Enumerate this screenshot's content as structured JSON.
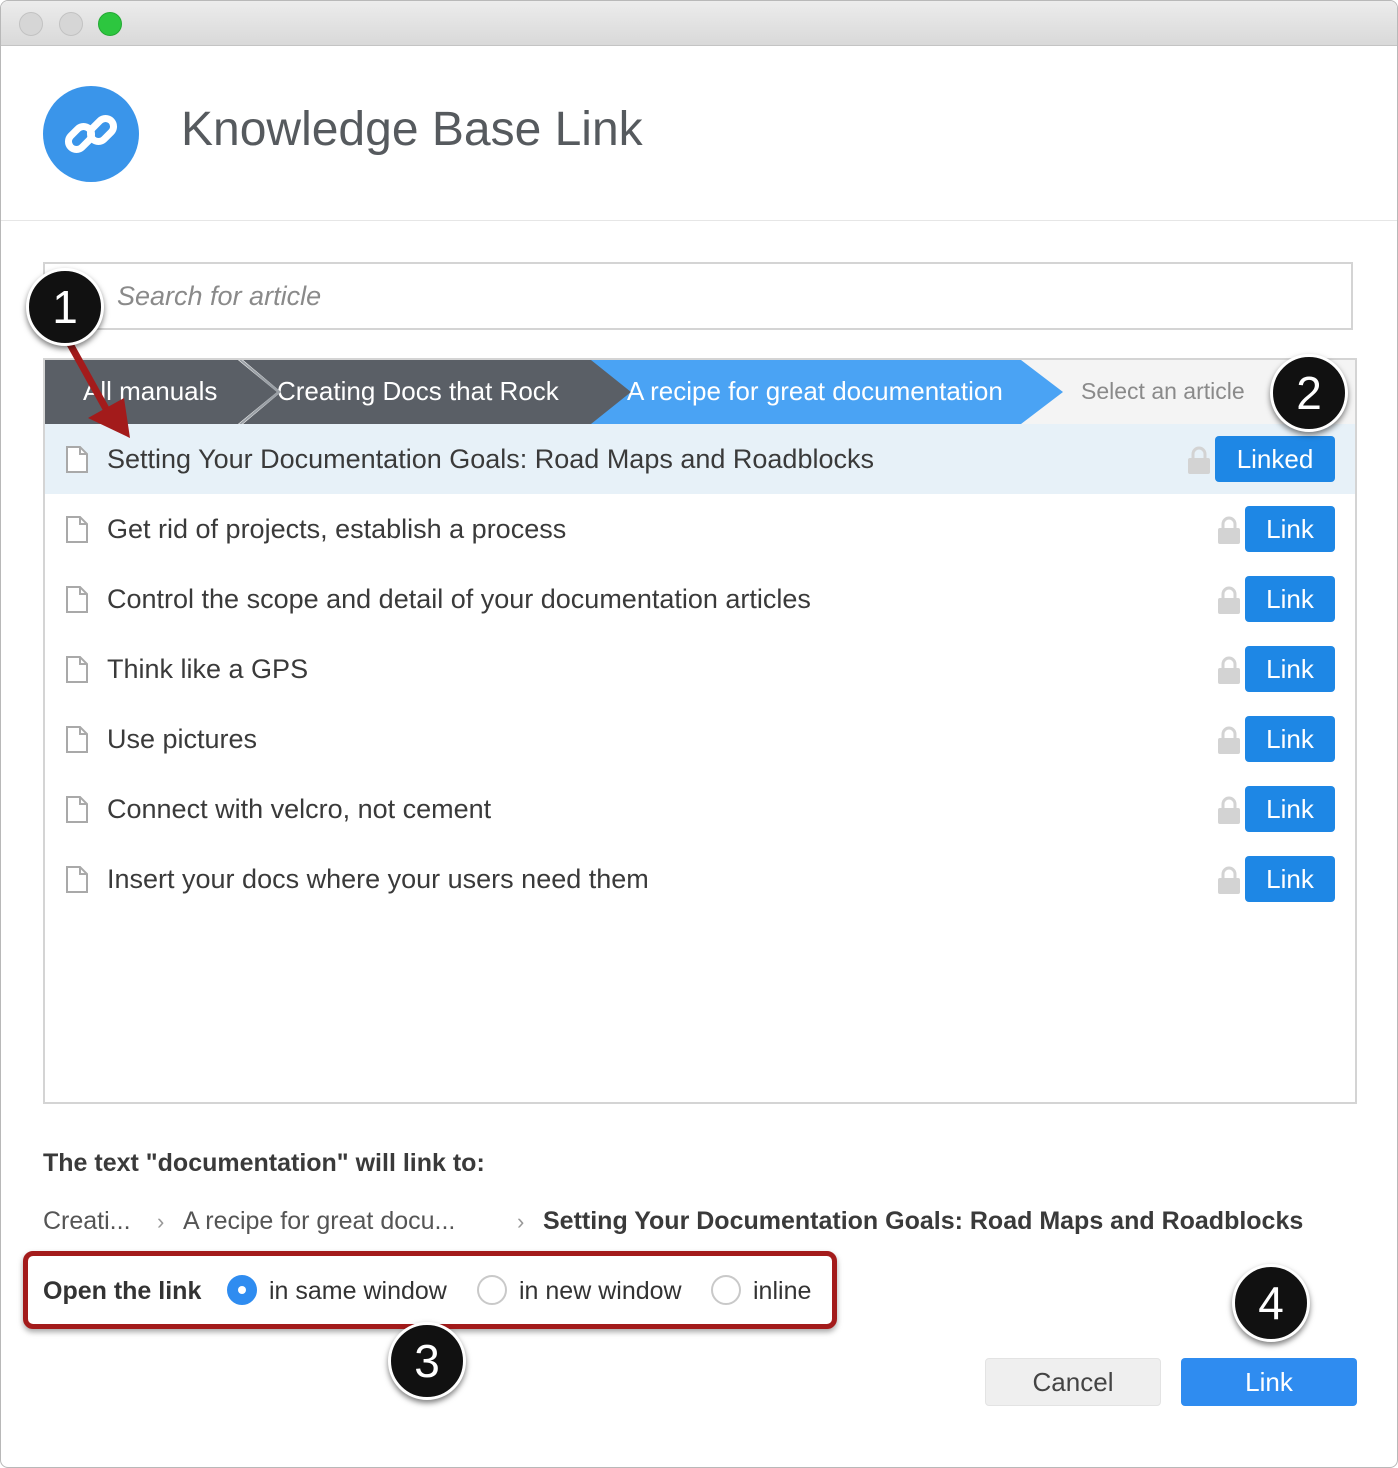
{
  "dialog": {
    "title": "Knowledge Base Link"
  },
  "search": {
    "placeholder": "Search for article"
  },
  "breadcrumbs": [
    {
      "label": "All manuals"
    },
    {
      "label": "Creating Docs that Rock"
    },
    {
      "label": "A recipe for great documentation"
    },
    {
      "label": "Select an article"
    }
  ],
  "articles": [
    {
      "title": "Setting Your Documentation Goals: Road Maps and Roadblocks",
      "button": "Linked",
      "selected": true
    },
    {
      "title": "Get rid of projects, establish a process",
      "button": "Link"
    },
    {
      "title": "Control the scope and detail of your documentation articles",
      "button": "Link"
    },
    {
      "title": "Think like a GPS",
      "button": "Link"
    },
    {
      "title": "Use pictures",
      "button": "Link"
    },
    {
      "title": "Connect with velcro, not cement",
      "button": "Link"
    },
    {
      "title": "Insert your docs where your users need them",
      "button": "Link"
    }
  ],
  "link_target": {
    "heading": "The text \"documentation\" will link to:",
    "path": [
      "Creati...",
      "A recipe for great docu...",
      "Setting Your Documentation Goals: Road Maps and Roadblocks"
    ],
    "separator": "›"
  },
  "open_link": {
    "label": "Open the link",
    "options": [
      {
        "label": "in same window",
        "selected": true
      },
      {
        "label": "in new window",
        "selected": false
      },
      {
        "label": "inline",
        "selected": false
      }
    ]
  },
  "actions": {
    "cancel": "Cancel",
    "link": "Link"
  },
  "callouts": [
    "1",
    "2",
    "3",
    "4"
  ],
  "colors": {
    "accent": "#1e87e5",
    "callout_border": "#a31b1b",
    "arrow": "#a31b1b"
  }
}
